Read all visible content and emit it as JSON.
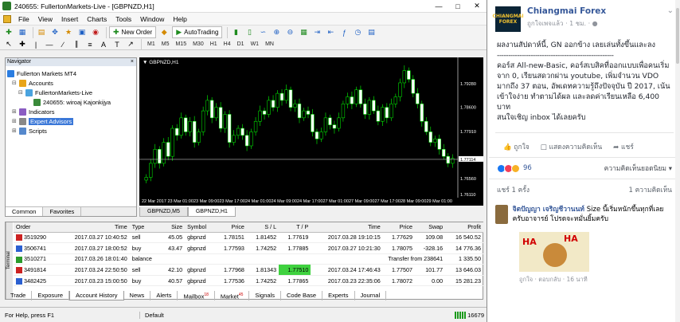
{
  "window": {
    "title": "240655: FullertonMarkets-Live - [GBPNZD,H1]"
  },
  "menu": [
    "File",
    "View",
    "Insert",
    "Charts",
    "Tools",
    "Window",
    "Help"
  ],
  "toolbar": {
    "new_order": "New Order",
    "autotrading": "AutoTrading"
  },
  "timeframes": [
    "M1",
    "M5",
    "M15",
    "M30",
    "H1",
    "H4",
    "D1",
    "W1",
    "MN"
  ],
  "navigator": {
    "title": "Navigator",
    "items": [
      {
        "label": "Fullerton Markets MT4",
        "color": "#2a7de1"
      },
      {
        "label": "Accounts",
        "color": "#e8a51a"
      },
      {
        "label": "FullertonMarkets-Live",
        "color": "#4aa3df"
      },
      {
        "label": "240655: wiroaj Kajonkijya",
        "color": "#3a8a3a"
      },
      {
        "label": "Indicators",
        "color": "#8a5cc2"
      },
      {
        "label": "Expert Advisors",
        "color": "#888888"
      },
      {
        "label": "Scripts",
        "color": "#5588cc"
      }
    ],
    "tabs": [
      "Common",
      "Favorites"
    ]
  },
  "chart": {
    "symbol_label": "GBPNZD,H1",
    "price_labels": [
      "1.79280",
      "1.78600",
      "1.77910",
      "1.77114",
      "1.76560",
      "1.76110"
    ],
    "time_labels": [
      "22 Mar 2017",
      "23 Mar 01:00",
      "23 Mar 09:00",
      "23 Mar 17:00",
      "24 Mar 01:00",
      "24 Mar 09:00",
      "24 Mar 17:00",
      "27 Mar 01:00",
      "27 Mar 09:00",
      "27 Mar 17:00",
      "28 Mar 09:00",
      "29 Mar 01:00"
    ],
    "tabs": [
      "GBPNZD,M5",
      "GBPNZD,H1"
    ]
  },
  "chart_data": {
    "type": "candlestick",
    "title": "GBPNZD,H1",
    "ylim": [
      1.7611,
      1.798
    ],
    "current_price": 1.77114,
    "closes": [
      1.766,
      1.77,
      1.774,
      1.77,
      1.776,
      1.772,
      1.78,
      1.778,
      1.783,
      1.779,
      1.782,
      1.776,
      1.779,
      1.785,
      1.788,
      1.783,
      1.786,
      1.78,
      1.784,
      1.776,
      1.778,
      1.78,
      1.778,
      1.775,
      1.779,
      1.782,
      1.785,
      1.784,
      1.788,
      1.786,
      1.79,
      1.788,
      1.791,
      1.786,
      1.787,
      1.783,
      1.785,
      1.784,
      1.779,
      1.777,
      1.779,
      1.783,
      1.781,
      1.78,
      1.783,
      1.787,
      1.789,
      1.787,
      1.791,
      1.787,
      1.784,
      1.788,
      1.785,
      1.782,
      1.786,
      1.783,
      1.787,
      1.789,
      1.793,
      1.7965,
      1.794,
      1.79,
      1.787,
      1.782,
      1.779,
      1.776,
      1.777,
      1.774,
      1.772,
      1.77,
      1.7714
    ]
  },
  "terminal": {
    "side_label": "Terminal",
    "columns": [
      "Order",
      "Time",
      "Type",
      "Size",
      "Symbol",
      "Price",
      "S / L",
      "T / P",
      "Time",
      "Price",
      "Swap",
      "Profit"
    ],
    "rows": [
      [
        "3519290",
        "2017.03.27 10:40:52",
        "sell",
        "45.05",
        "gbpnzd",
        "1.78151",
        "1.81452",
        "1.77619",
        "2017.03.28 19:10:15",
        "1.77629",
        "109.08",
        "16 540.52"
      ],
      [
        "3506741",
        "2017.03.27 18:00:52",
        "buy",
        "43.47",
        "gbpnzd",
        "1.77593",
        "1.74252",
        "1.77885",
        "2017.03.27 10:21:30",
        "1.78075",
        "-328.16",
        "14 776.36"
      ],
      [
        "3510271",
        "2017.03.26 18:01:40",
        "balance",
        "",
        "",
        "",
        "",
        "",
        "Transfer from 238641",
        "",
        "",
        "1 335.50"
      ],
      [
        "3491814",
        "2017.03.24 22:50:50",
        "sell",
        "42.10",
        "gbpnzd",
        "1.77968",
        "1.81343",
        "1.77510",
        "2017.03.24 17:46:43",
        "1.77507",
        "101.77",
        "13 646.03"
      ],
      [
        "3482425",
        "2017.03.23 15:00:50",
        "buy",
        "40.57",
        "gbpnzd",
        "1.77536",
        "1.74252",
        "1.77865",
        "2017.03.23 22:35:06",
        "1.78072",
        "0.00",
        "15 281.23"
      ]
    ],
    "tabs": [
      "Trade",
      "Exposure",
      "Account History",
      "News",
      "Alerts",
      "Mailbox",
      "Market",
      "Signals",
      "Code Base",
      "Experts",
      "Journal"
    ],
    "mailbox_count": "18",
    "market_count": "45"
  },
  "status": {
    "help": "For Help, press F1",
    "profile": "Default",
    "conn": "16679"
  },
  "fb": {
    "page_name": "Chiangmai Forex",
    "sub": "ถูกใจเพจแล้ว · 1 ชม. · ",
    "avatar_text": "CHIANGMAI FOREX",
    "line1": "ผลงานสัปดาห์นี้, GN ออกข้าง เลยเล่นทั้งขึ้นและลง",
    "dashes": "----------------------------------------------------",
    "body": "คอร์ส All-new-Basic, คอร์สเบสิคที่ออกแบบเพื่อคนเริ่มจาก 0, เรียนสดวกผ่าน youtube, เพิ่มจำนวน VDO มากถึง 37 ตอน, อัพเดทความรู้ถึงปัจจุบัน ปี 2017, เน้นเข้าใจง่าย ทำตามได้ผล และลดค่าเรียนเหลือ 6,400 บาท",
    "body2": "สนใจเชิญ inbox ได้เลยครับ",
    "like": "ถูกใจ",
    "comment": "แสดงความคิดเห็น",
    "share": "แชร์",
    "reactions": "96",
    "sort": "ความคิดเห็นยอดนิยม",
    "shares": "แชร์ 1 ครั้ง",
    "comments_count": "1 ความคิดเห็น",
    "commenter": "จิตปัญญา เจริญชีวานนท์",
    "comment_text": "Size นี้เริ่มหนักขึ้นทุกที่เลยครับอาจารย์ โปรดจะหมั่นยิ้มครับ",
    "meme_text": "HA",
    "comment_time": "ถูกใจ · ตอบกลับ · 16 นาที"
  }
}
